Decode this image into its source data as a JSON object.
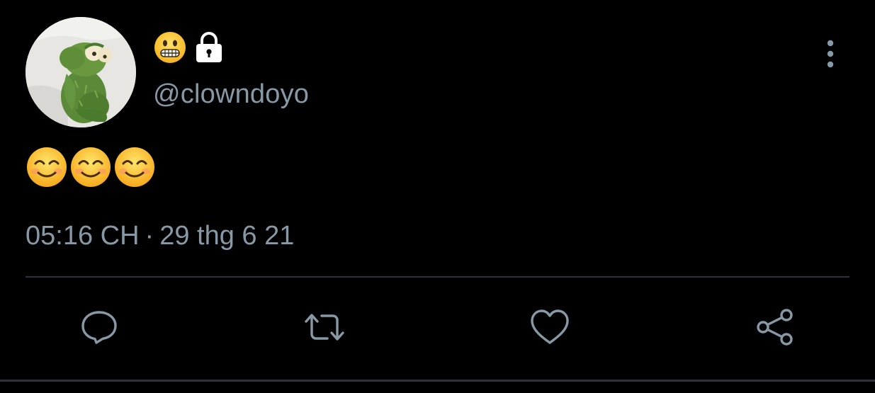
{
  "tweet": {
    "display_name_icons": [
      "grimacing-face-emoji",
      "lock-icon"
    ],
    "handle": "@clowndoyo",
    "body_emojis": [
      "smiling-face-with-smiling-eyes",
      "smiling-face-with-smiling-eyes",
      "smiling-face-with-smiling-eyes"
    ],
    "time": "05:16 CH",
    "separator": "·",
    "date": "29 thg 6 21"
  },
  "actions": [
    {
      "name": "reply",
      "icon": "comment-icon"
    },
    {
      "name": "retweet",
      "icon": "retweet-icon"
    },
    {
      "name": "like",
      "icon": "heart-icon"
    },
    {
      "name": "share",
      "icon": "share-icon"
    }
  ],
  "colors": {
    "background": "#000000",
    "secondary_text": "#8899a6",
    "divider": "#2f3336",
    "icon": "#8899a6"
  }
}
